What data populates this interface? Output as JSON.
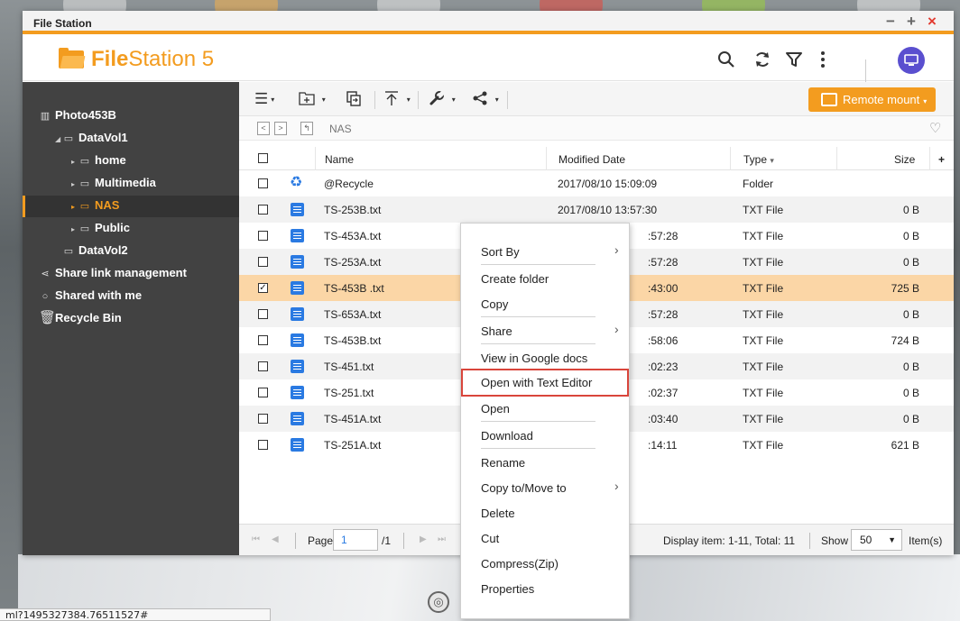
{
  "window": {
    "title": "File Station"
  },
  "header": {
    "logo_bold": "File",
    "logo_rest": "Station 5",
    "icons": [
      "search-icon",
      "refresh-icon",
      "filter-icon",
      "more-icon",
      "avatar-icon"
    ]
  },
  "sidebar": {
    "items": [
      {
        "label": "Photo453B",
        "icon": "nas-icon"
      },
      {
        "label": "DataVol1",
        "icon": "volume-icon"
      },
      {
        "label": "home",
        "icon": "folder-icon"
      },
      {
        "label": "Multimedia",
        "icon": "folder-icon"
      },
      {
        "label": "NAS",
        "icon": "folder-icon",
        "active": true
      },
      {
        "label": "Public",
        "icon": "folder-icon"
      },
      {
        "label": "DataVol2",
        "icon": "volume-icon"
      },
      {
        "label": "Share link management",
        "icon": "share-icon"
      },
      {
        "label": "Shared with me",
        "icon": "shared-icon"
      },
      {
        "label": "Recycle Bin",
        "icon": "trash-icon"
      }
    ]
  },
  "toolbar": {
    "remote_mount": "Remote mount",
    "icons": [
      "list-view-icon",
      "new-folder-icon",
      "copy-icon",
      "upload-icon",
      "tools-icon",
      "share-icon"
    ]
  },
  "path": {
    "current": "NAS"
  },
  "columns": {
    "name": "Name",
    "modified": "Modified Date",
    "type": "Type",
    "size": "Size",
    "add": "+"
  },
  "files": [
    {
      "name": "@Recycle",
      "modified": "2017/08/10 15:09:09",
      "type": "Folder",
      "size": "",
      "icon": "recycle-icon"
    },
    {
      "name": "TS-253B.txt",
      "modified": "2017/08/10 13:57:30",
      "type": "TXT File",
      "size": "0 B",
      "icon": "text-file-icon"
    },
    {
      "name": "TS-453A.txt",
      "modified": ":57:28",
      "type": "TXT File",
      "size": "0 B",
      "icon": "text-file-icon"
    },
    {
      "name": "TS-253A.txt",
      "modified": ":57:28",
      "type": "TXT File",
      "size": "0 B",
      "icon": "text-file-icon"
    },
    {
      "name": "TS-453B .txt",
      "modified": ":43:00",
      "type": "TXT File",
      "size": "725 B",
      "icon": "text-file-icon",
      "selected": true
    },
    {
      "name": "TS-653A.txt",
      "modified": ":57:28",
      "type": "TXT File",
      "size": "0 B",
      "icon": "text-file-icon"
    },
    {
      "name": "TS-453B.txt",
      "modified": ":58:06",
      "type": "TXT File",
      "size": "724 B",
      "icon": "text-file-icon"
    },
    {
      "name": "TS-451.txt",
      "modified": ":02:23",
      "type": "TXT File",
      "size": "0 B",
      "icon": "text-file-icon"
    },
    {
      "name": "TS-251.txt",
      "modified": ":02:37",
      "type": "TXT File",
      "size": "0 B",
      "icon": "text-file-icon"
    },
    {
      "name": "TS-451A.txt",
      "modified": ":03:40",
      "type": "TXT File",
      "size": "0 B",
      "icon": "text-file-icon"
    },
    {
      "name": "TS-251A.txt",
      "modified": ":14:11",
      "type": "TXT File",
      "size": "621 B",
      "icon": "text-file-icon"
    }
  ],
  "footer": {
    "page_label": "Page",
    "page_value": "1",
    "page_total": "/1",
    "display": "Display item: 1-11, Total: 11",
    "show_label": "Show",
    "show_value": "50",
    "items_label": "Item(s)"
  },
  "context_menu": {
    "items": [
      {
        "label": "Sort By",
        "submenu": true
      },
      {
        "label": "Create folder"
      },
      {
        "label": "Copy"
      },
      {
        "label": "Share",
        "submenu": true
      },
      {
        "label": "View in Google docs"
      },
      {
        "label": "Open with Text Editor",
        "highlighted": true
      },
      {
        "label": "Open"
      },
      {
        "label": "Download"
      },
      {
        "label": "Rename"
      },
      {
        "label": "Copy to/Move to",
        "submenu": true
      },
      {
        "label": "Delete"
      },
      {
        "label": "Cut"
      },
      {
        "label": "Compress(Zip)"
      },
      {
        "label": "Properties"
      }
    ]
  },
  "status_url": "ml?1495327384.76511527#",
  "colors": {
    "accent": "#f39c1f",
    "sidebar": "#424242",
    "selected_row": "#fbd6a6",
    "highlight_border": "#d9453b",
    "file_icon": "#2a7ae2"
  }
}
